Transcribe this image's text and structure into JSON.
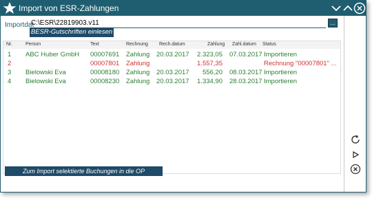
{
  "window": {
    "title": "Import von ESR-Zahlungen"
  },
  "import": {
    "label": "Importdat",
    "path": "C:\\ESR\\22819903.v11",
    "browse_label": "...",
    "read_button": "BESR-Gutschriften einlesen"
  },
  "table": {
    "headers": [
      "Nr.",
      "Person",
      "Text",
      "Rechnung",
      "Rech.datum",
      "Zahlung",
      "Zahl.datum",
      "Status"
    ],
    "rows": [
      {
        "nr": "1",
        "person": "ABC Huber GmbH",
        "text": "00007691",
        "rechnung": "Zahlung",
        "rech_datum": "20.03.2017",
        "zahlung": "2.323,05",
        "zahl_datum": "07.03.2017",
        "status": "Importieren",
        "color": "#2e7d32"
      },
      {
        "nr": "2",
        "person": "",
        "text": "00007801",
        "rechnung": "Zahlung",
        "rech_datum": "",
        "zahlung": "1.557,35",
        "zahl_datum": "",
        "status": "Rechnung \"00007801\" ...",
        "color": "#d32f2f"
      },
      {
        "nr": "3",
        "person": "Bielowski Eva",
        "text": "00008180",
        "rechnung": "Zahlung",
        "rech_datum": "20.03.2017",
        "zahlung": "556,20",
        "zahl_datum": "08.03.2017",
        "status": "Importieren",
        "color": "#2e7d32"
      },
      {
        "nr": "4",
        "person": "Bielowski Eva",
        "text": "00008230",
        "rechnung": "Zahlung",
        "rech_datum": "20.03.2017",
        "zahlung": "1.334,90",
        "zahl_datum": "28.03.2017",
        "status": "Importieren",
        "color": "#2e7d32"
      }
    ]
  },
  "footer": {
    "apply_button": "Zum Import selektierte Buchungen in die OP übernehmen"
  },
  "icons": {
    "logo": "star-logo-icon",
    "minimize": "chevron-down-icon",
    "maximize": "chevron-up-icon",
    "close": "close-icon",
    "refresh": "refresh-icon",
    "run": "play-icon",
    "cancel": "cancel-circle-icon"
  },
  "colors": {
    "titlebar": "#1f5e70",
    "button": "#1f4a68",
    "ok": "#2e7d32",
    "error": "#d32f2f"
  }
}
